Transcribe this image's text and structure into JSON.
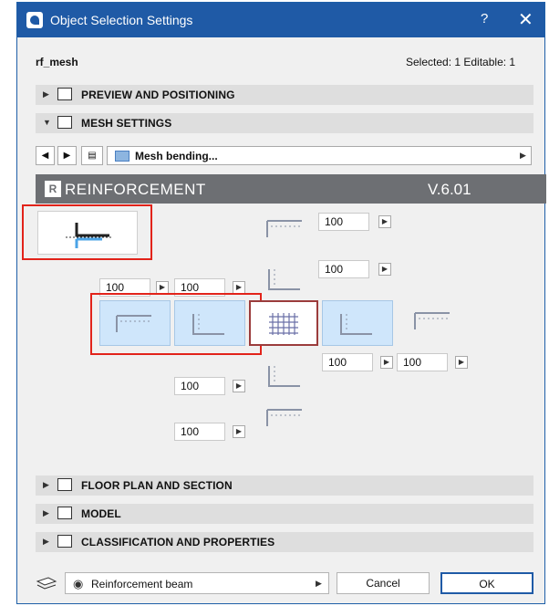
{
  "window": {
    "title": "Object Selection Settings",
    "help": "?",
    "close": "✕"
  },
  "object": {
    "name": "rf_mesh",
    "selection_status": "Selected: 1 Editable: 1"
  },
  "sections": {
    "preview": "PREVIEW AND POSITIONING",
    "mesh": "MESH SETTINGS",
    "floor": "FLOOR PLAN AND SECTION",
    "model": "MODEL",
    "classification": "CLASSIFICATION AND PROPERTIES"
  },
  "nav": {
    "prev": "◀",
    "next": "▶",
    "page_label": "Mesh bending...",
    "dropdown_arrow": "▶"
  },
  "banner": {
    "logo": "R",
    "name": "REINFORCEMENT",
    "version": "V.6.01"
  },
  "fields": {
    "top_right_1": "100",
    "top_right_2": "100",
    "left_1": "100",
    "left_2": "100",
    "right_1": "100",
    "right_2": "100",
    "bottom_1": "100",
    "bottom_2": "100"
  },
  "footer": {
    "layer_name": "Reinforcement beam",
    "cancel": "Cancel",
    "ok": "OK"
  },
  "icons": [
    "app-icon",
    "help-icon",
    "close-icon",
    "expand-arrow-icon",
    "collapse-arrow-icon",
    "preview-icon",
    "mesh-settings-icon",
    "floor-plan-icon",
    "model-icon",
    "classification-icon",
    "favorites-icon",
    "eye-icon",
    "layer-icon",
    "bend-type-icon",
    "mesh-grid-icon"
  ]
}
